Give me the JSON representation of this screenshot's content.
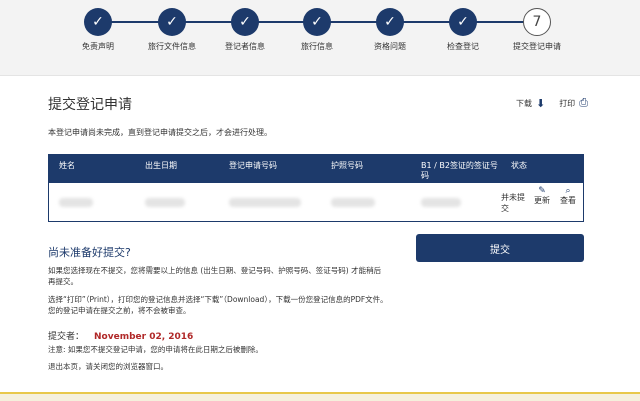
{
  "stepper": {
    "steps": [
      {
        "label": "免责声明",
        "mark": "✓"
      },
      {
        "label": "旅行文件信息",
        "mark": "✓"
      },
      {
        "label": "登记者信息",
        "mark": "✓"
      },
      {
        "label": "旅行信息",
        "mark": "✓"
      },
      {
        "label": "资格问题",
        "mark": "✓"
      },
      {
        "label": "检查登记",
        "mark": "✓"
      },
      {
        "label": "提交登记申请",
        "mark": "7"
      }
    ]
  },
  "page": {
    "title": "提交登记申请",
    "download_label": "下载",
    "print_label": "打印",
    "notice": "本登记申请尚未完成，直到登记申请提交之后，才会进行处理。"
  },
  "table": {
    "headers": [
      "姓名",
      "出生日期",
      "登记申请号码",
      "护照号码",
      "B1 / B2签证的签证号码",
      "状态"
    ],
    "row": {
      "status": "并未提交",
      "update_label": "更新",
      "view_label": "查看"
    }
  },
  "not_ready": {
    "title": "尚未准备好提交?",
    "para1": "如果您选择现在不提交，您将需要以上的信息 (出生日期、登记号码、护照号码、签证号码) 才能稍后再提交。",
    "para2": "选择“打印”（Print），打印您的登记信息并选择“下载”（Download），下载一份您登记信息的PDF文件。您的登记申请在提交之前，将不会被审查。",
    "submitted_by_label": "提交者：",
    "submitted_by_date": "November 02, 2016",
    "para3": "注意: 如果您不提交登记申请，您的申请将在此日期之后被删除。",
    "para4": "退出本页，请关闭您的浏览器窗口。"
  },
  "submit_label": "提交",
  "colors": {
    "navy": "#1d3a6b",
    "date_red": "#b02828"
  }
}
